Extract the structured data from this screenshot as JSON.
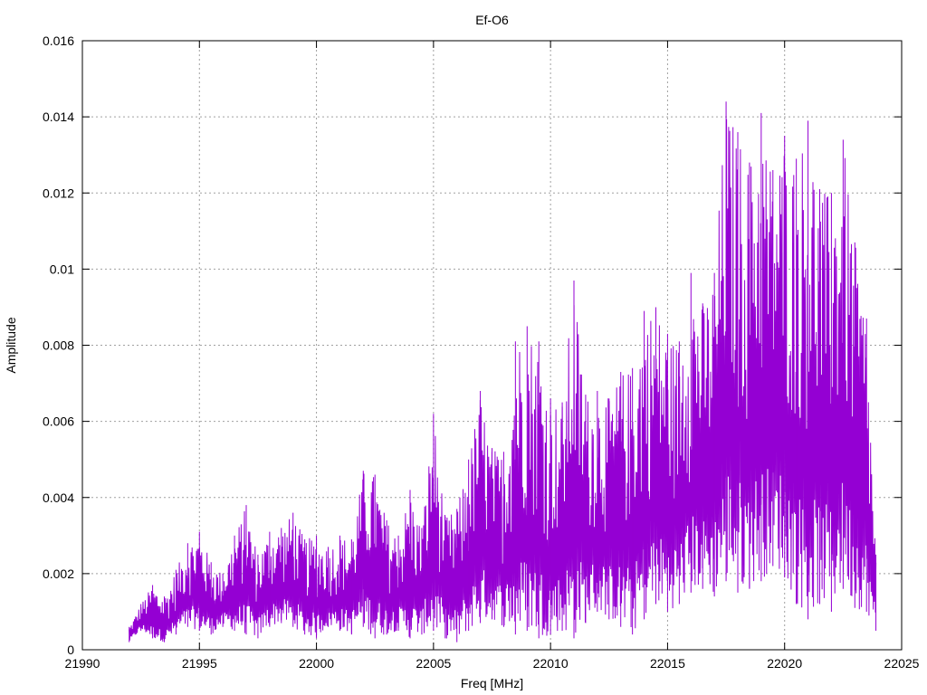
{
  "chart_data": {
    "type": "line",
    "title": "Ef-O6",
    "xlabel": "Freq [MHz]",
    "ylabel": "Amplitude",
    "xlim": [
      21990,
      22025
    ],
    "ylim": [
      0,
      0.016
    ],
    "x_ticks": [
      "21990",
      "21995",
      "22000",
      "22005",
      "22010",
      "22015",
      "22020",
      "22025"
    ],
    "y_ticks": [
      "0",
      "0.002",
      "0.004",
      "0.006",
      "0.008",
      "0.01",
      "0.012",
      "0.014",
      "0.016"
    ],
    "grid": true,
    "legend": "none",
    "line_color": "#9400d3",
    "series": [
      {
        "x": [
          21992.0,
          21992.5,
          21993.0,
          21993.5,
          21994.0,
          21994.5,
          21995.0,
          21995.5,
          21996.0,
          21996.5,
          21997.0,
          21997.5,
          21998.0,
          21998.5,
          21999.0,
          21999.5,
          22000.0,
          22000.5,
          22001.0,
          22001.5,
          22002.0,
          22002.5,
          22003.0,
          22003.5,
          22004.0,
          22004.5,
          22005.0,
          22005.5,
          22006.0,
          22006.5,
          22007.0,
          22007.5,
          22008.0,
          22008.5,
          22009.0,
          22009.5,
          22010.0,
          22010.5,
          22011.0,
          22011.5,
          22012.0,
          22012.5,
          22013.0,
          22013.5,
          22014.0,
          22014.5,
          22015.0,
          22015.5,
          22016.0,
          22016.5,
          22017.0,
          22017.5,
          22018.0,
          22018.5,
          22019.0,
          22019.5,
          22020.0,
          22020.5,
          22021.0,
          22021.5,
          22022.0,
          22022.5,
          22023.0,
          22023.5,
          22023.9
        ],
        "y_low": [
          0.0002,
          0.0005,
          0.0003,
          0.0002,
          0.0004,
          0.0006,
          0.0005,
          0.0004,
          0.0006,
          0.0005,
          0.0004,
          0.0003,
          0.0006,
          0.0007,
          0.0006,
          0.0004,
          0.0003,
          0.0006,
          0.0005,
          0.0004,
          0.0006,
          0.0003,
          0.0004,
          0.0005,
          0.0003,
          0.0004,
          0.0005,
          0.0003,
          0.0002,
          0.0005,
          0.0007,
          0.0008,
          0.0006,
          0.0004,
          0.0005,
          0.0003,
          0.0004,
          0.0005,
          0.0003,
          0.0007,
          0.001,
          0.0008,
          0.0006,
          0.0004,
          0.0008,
          0.0012,
          0.001,
          0.0012,
          0.0015,
          0.0016,
          0.0014,
          0.0018,
          0.0015,
          0.0016,
          0.0018,
          0.0022,
          0.0019,
          0.0012,
          0.0008,
          0.0012,
          0.001,
          0.0016,
          0.0011,
          0.001,
          0.0005
        ],
        "y_high": [
          0.0006,
          0.0012,
          0.0017,
          0.0014,
          0.0021,
          0.0028,
          0.0031,
          0.0023,
          0.002,
          0.003,
          0.0038,
          0.0025,
          0.0031,
          0.0032,
          0.0036,
          0.0029,
          0.003,
          0.0027,
          0.003,
          0.0029,
          0.0047,
          0.0046,
          0.0034,
          0.003,
          0.0042,
          0.0032,
          0.0062,
          0.0035,
          0.0037,
          0.005,
          0.0068,
          0.0053,
          0.0052,
          0.0081,
          0.0085,
          0.0081,
          0.0066,
          0.0065,
          0.0097,
          0.0067,
          0.0068,
          0.0066,
          0.0073,
          0.0074,
          0.0089,
          0.009,
          0.0083,
          0.0081,
          0.0099,
          0.0091,
          0.0099,
          0.0144,
          0.0136,
          0.0128,
          0.0141,
          0.0126,
          0.0135,
          0.0129,
          0.0139,
          0.0121,
          0.012,
          0.0134,
          0.0107,
          0.0087,
          0.0025
        ]
      }
    ]
  }
}
